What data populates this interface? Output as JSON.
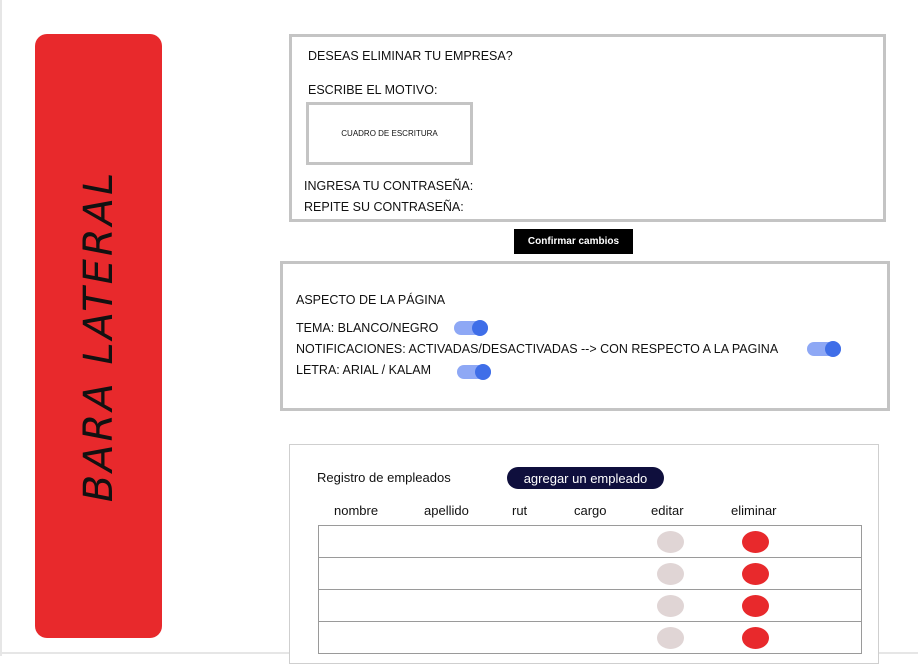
{
  "sidebar": {
    "label": "BARA LATERAL"
  },
  "delete_section": {
    "question": "DESEAS ELIMINAR TU EMPRESA?",
    "reason_label": "ESCRIBE EL MOTIVO:",
    "writing_box_label": "CUADRO DE ESCRITURA",
    "password_label": "INGRESA TU CONTRASEÑA:",
    "repeat_password_label": "REPITE SU CONTRASEÑA:"
  },
  "confirm_button": "Confirmar cambios",
  "appearance": {
    "title": "ASPECTO DE LA PÁGINA",
    "theme_label": "TEMA: BLANCO/NEGRO",
    "notifications_label": "NOTIFICACIONES: ACTIVADAS/DESACTIVADAS --> CON RESPECTO A LA PAGINA",
    "font_label": "LETRA: ARIAL / KALAM",
    "toggle_color": "#3f6ee8"
  },
  "employees": {
    "title": "Registro de empleados",
    "add_button": "agregar un empleado",
    "columns": [
      "nombre",
      "apellido",
      "rut",
      "cargo",
      "editar",
      "eliminar"
    ],
    "row_count": 4,
    "delete_color": "#e8292c",
    "edit_color": "#e0d5d5"
  }
}
